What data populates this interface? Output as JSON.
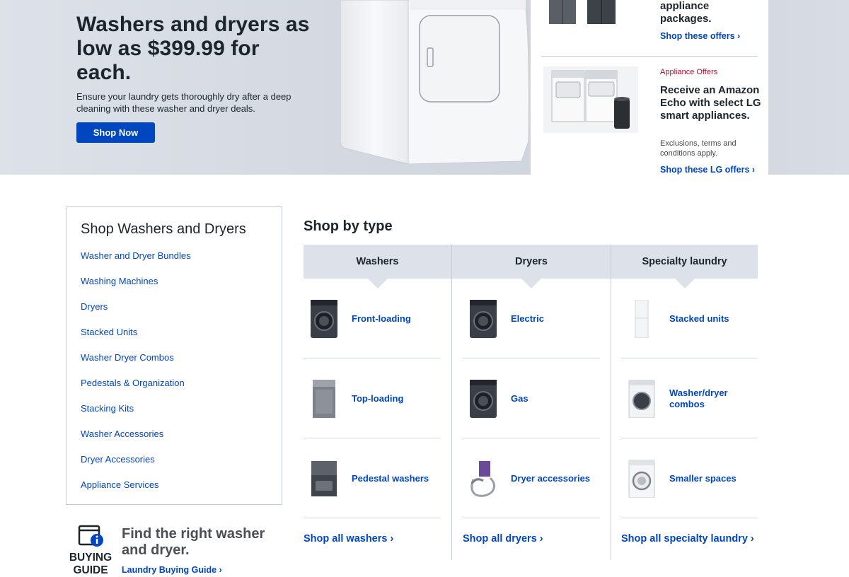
{
  "hero": {
    "title": "Washers and dryers as low as $399.99 for each.",
    "subtitle": "Ensure your laundry gets thoroughly dry after a deep cleaning with these washer and dryer deals.",
    "cta": "Shop Now"
  },
  "offers": {
    "offer1_text": "appliance packages.",
    "offer1_link": "Shop these offers ›",
    "offer2_label": "Appliance Offers",
    "offer2_text": "Receive an Amazon Echo with select LG smart appliances.",
    "offer2_fine": "Exclusions, terms and conditions apply.",
    "offer2_link": "Shop these LG offers ›"
  },
  "sidebar": {
    "title": "Shop Washers and Dryers",
    "items": [
      "Washer and Dryer Bundles",
      "Washing Machines",
      "Dryers",
      "Stacked Units",
      "Washer Dryer Combos",
      "Pedestals & Organization",
      "Stacking Kits",
      "Washer Accessories",
      "Dryer Accessories",
      "Appliance Services"
    ]
  },
  "buying_guide": {
    "icon_word1": "BUYING",
    "icon_word2": "GUIDE",
    "title": "Find the right washer and dryer.",
    "link": "Laundry Buying Guide ›"
  },
  "shop_by_type": {
    "title": "Shop by type",
    "columns": [
      {
        "heading": "Washers",
        "items": [
          "Front-loading",
          "Top-loading",
          "Pedestal washers"
        ],
        "shop_all": "Shop all washers ›"
      },
      {
        "heading": "Dryers",
        "items": [
          "Electric",
          "Gas",
          "Dryer accessories"
        ],
        "shop_all": "Shop all dryers ›"
      },
      {
        "heading": "Specialty laundry",
        "items": [
          "Stacked units",
          "Washer/dryer combos",
          "Smaller spaces"
        ],
        "shop_all": "Shop all specialty laundry ›"
      }
    ]
  },
  "colors": {
    "accent_blue": "#0046be",
    "offer_red": "#bb0628",
    "header_gray": "#dde1ea"
  }
}
